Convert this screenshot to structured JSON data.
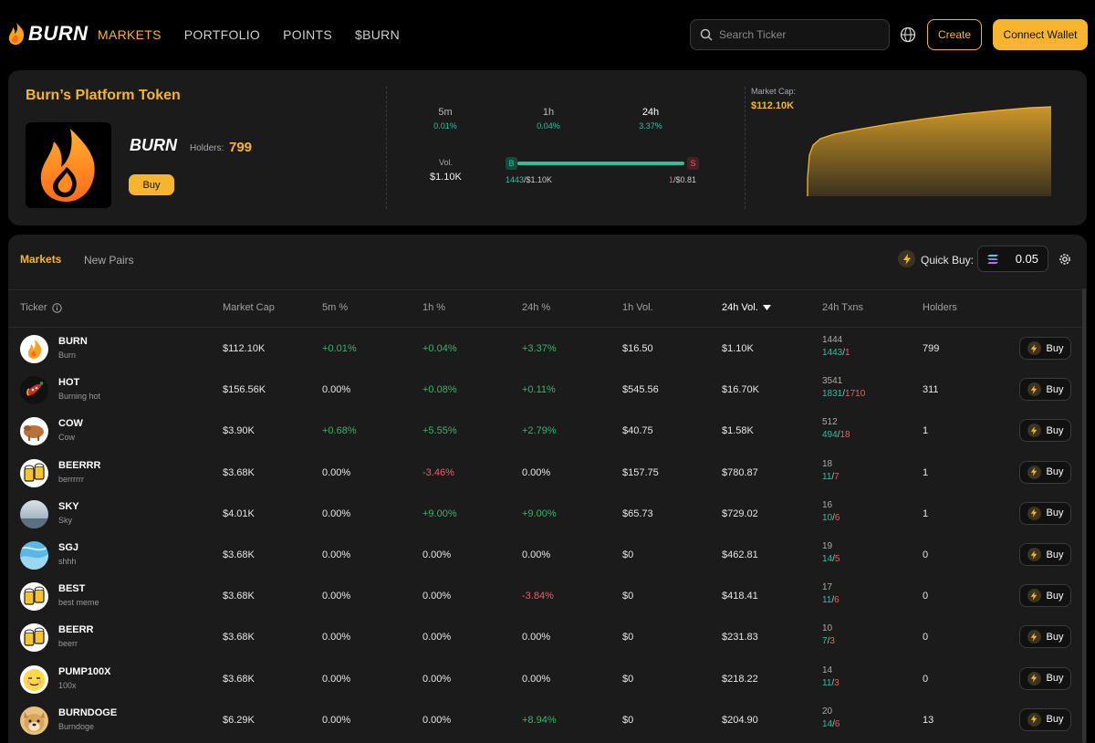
{
  "nav": {
    "logo_text": "BURN",
    "links": [
      "MARKETS",
      "PORTFOLIO",
      "POINTS",
      "$BURN"
    ],
    "search_placeholder": "Search Ticker",
    "create_label": "Create",
    "connect_label": "Connect Wallet"
  },
  "platform": {
    "title": "Burn’s Platform Token",
    "token_name": "BURN",
    "holders_label": "Holders:",
    "holders": "799",
    "buy_label": "Buy",
    "timeframes": [
      {
        "label": "5m",
        "value": "0.01%"
      },
      {
        "label": "1h",
        "value": "0.04%"
      },
      {
        "label": "24h",
        "value": "3.37%"
      }
    ],
    "vol_label": "Vol.",
    "vol_value": "$1.10K",
    "buy_tag": "B",
    "sell_tag": "S",
    "buy_count": "1443",
    "buy_amount": "/$1.10K",
    "sell_count": "1",
    "sell_amount": "/$0.81",
    "market_cap_label": "Market Cap:",
    "market_cap_value": "$112.10K"
  },
  "markets": {
    "tabs": [
      "Markets",
      "New Pairs"
    ],
    "quick_buy_label": "Quick Buy:",
    "quick_buy_value": "0.05",
    "columns": [
      "Ticker",
      "Market Cap",
      "5m %",
      "1h %",
      "24h %",
      "1h Vol.",
      "24h Vol.",
      "24h Txns",
      "Holders"
    ],
    "sorted_column": "24h Vol.",
    "buy_label": "Buy",
    "rows": [
      {
        "symbol": "BURN",
        "name": "Burn",
        "mcap": "$112.10K",
        "m5": "+0.01%",
        "h1": "+0.04%",
        "h24": "+3.37%",
        "vol1h": "$16.50",
        "vol24h": "$1.10K",
        "txns": "1444",
        "buys": "1443",
        "sells": "1",
        "holders": "799"
      },
      {
        "symbol": "HOT",
        "name": "Burning hot",
        "mcap": "$156.56K",
        "m5": "0.00%",
        "h1": "+0.08%",
        "h24": "+0.11%",
        "vol1h": "$545.56",
        "vol24h": "$16.70K",
        "txns": "3541",
        "buys": "1831",
        "sells": "1710",
        "holders": "311"
      },
      {
        "symbol": "COW",
        "name": "Cow",
        "mcap": "$3.90K",
        "m5": "+0.68%",
        "h1": "+5.55%",
        "h24": "+2.79%",
        "vol1h": "$40.75",
        "vol24h": "$1.58K",
        "txns": "512",
        "buys": "494",
        "sells": "18",
        "holders": "1"
      },
      {
        "symbol": "BEERRR",
        "name": "berrrrrr",
        "mcap": "$3.68K",
        "m5": "0.00%",
        "h1": "-3.46%",
        "h24": "0.00%",
        "vol1h": "$157.75",
        "vol24h": "$780.87",
        "txns": "18",
        "buys": "11",
        "sells": "7",
        "holders": "1"
      },
      {
        "symbol": "SKY",
        "name": "Sky",
        "mcap": "$4.01K",
        "m5": "0.00%",
        "h1": "+9.00%",
        "h24": "+9.00%",
        "vol1h": "$65.73",
        "vol24h": "$729.02",
        "txns": "16",
        "buys": "10",
        "sells": "6",
        "holders": "1"
      },
      {
        "symbol": "SGJ",
        "name": "shhh",
        "mcap": "$3.68K",
        "m5": "0.00%",
        "h1": "0.00%",
        "h24": "0.00%",
        "vol1h": "$0",
        "vol24h": "$462.81",
        "txns": "19",
        "buys": "14",
        "sells": "5",
        "holders": "0"
      },
      {
        "symbol": "BEST",
        "name": "best meme",
        "mcap": "$3.68K",
        "m5": "0.00%",
        "h1": "0.00%",
        "h24": "-3.84%",
        "vol1h": "$0",
        "vol24h": "$418.41",
        "txns": "17",
        "buys": "11",
        "sells": "6",
        "holders": "0"
      },
      {
        "symbol": "BEERR",
        "name": "beerr",
        "mcap": "$3.68K",
        "m5": "0.00%",
        "h1": "0.00%",
        "h24": "0.00%",
        "vol1h": "$0",
        "vol24h": "$231.83",
        "txns": "10",
        "buys": "7",
        "sells": "3",
        "holders": "0"
      },
      {
        "symbol": "PUMP100X",
        "name": "100x",
        "mcap": "$3.68K",
        "m5": "0.00%",
        "h1": "0.00%",
        "h24": "0.00%",
        "vol1h": "$0",
        "vol24h": "$218.22",
        "txns": "14",
        "buys": "11",
        "sells": "3",
        "holders": "0"
      },
      {
        "symbol": "BURNDOGE",
        "name": "Burndoge",
        "mcap": "$6.29K",
        "m5": "0.00%",
        "h1": "0.00%",
        "h24": "+8.94%",
        "vol1h": "$0",
        "vol24h": "$204.90",
        "txns": "20",
        "buys": "14",
        "sells": "6",
        "holders": "13"
      }
    ]
  },
  "colors": {
    "accent": "#f6b52c",
    "positive": "#3bb26b",
    "negative": "#ef5a6f",
    "buy": "#2fbf9e",
    "panel": "#1b1b1b"
  }
}
